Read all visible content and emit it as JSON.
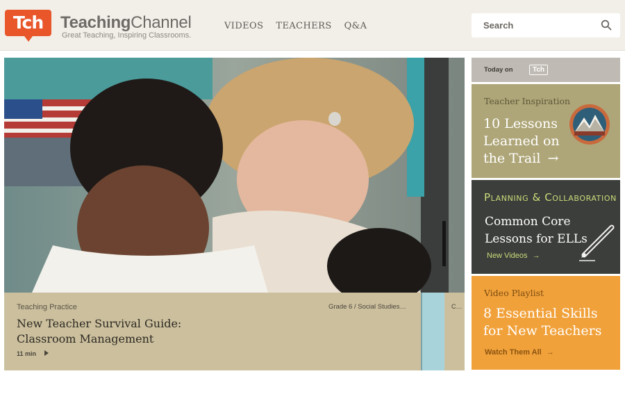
{
  "header": {
    "logo_text": "Tch",
    "brand_bold": "Teaching",
    "brand_regular": "Channel",
    "tagline": "Great Teaching, Inspiring Classrooms.",
    "nav": [
      "VIDEOS",
      "TEACHERS",
      "Q&A"
    ],
    "search_placeholder": "Search",
    "search_icon": "search-icon"
  },
  "hero": {
    "category": "Teaching Practice",
    "title": "New Teacher Survival Guide: Classroom Management",
    "duration": "11 min",
    "play_icon": "play-icon",
    "grade": "Grade 6 / Social Studies…",
    "strip_text": "C…"
  },
  "sidebar": {
    "today_label": "Today on",
    "today_badge": "Tch",
    "cards": [
      {
        "kicker": "Teacher Inspiration",
        "title": "10 Lessons Learned on the Trail",
        "arrow": "→",
        "icon": "mountain-badge-icon",
        "color": "#aea678"
      },
      {
        "kicker": "Planning & Collaboration",
        "title": "Common Core Lessons for ELLs",
        "link": "New Videos",
        "arrow": "→",
        "icon": "pencil-icon",
        "color": "#3c3e3b"
      },
      {
        "kicker": "Video Playlist",
        "title": "8 Essential Skills for New Teachers",
        "link": "Watch Them All",
        "arrow": "→",
        "color": "#f1a13a"
      }
    ]
  },
  "colors": {
    "brand_orange": "#e8562a",
    "header_bg": "#f2efe9",
    "caption_bg": "#cbbf9d"
  }
}
